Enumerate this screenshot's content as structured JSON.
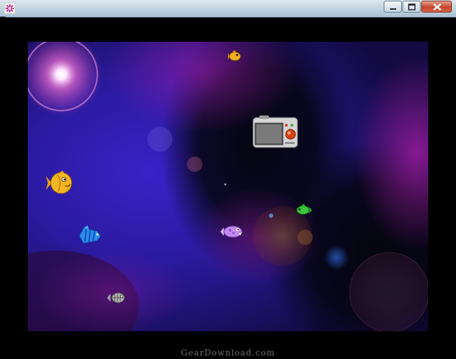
{
  "window": {
    "title": "",
    "app_icon": "starfish-gear-icon",
    "buttons": [
      {
        "name": "minimize",
        "icon": "minimize-icon"
      },
      {
        "name": "maximize",
        "icon": "maximize-icon"
      },
      {
        "name": "close",
        "icon": "close-icon"
      }
    ]
  },
  "scene": {
    "background": "nebula",
    "colors": {
      "deep_blue": "#2a1a9e",
      "magenta": "#8a1a8e",
      "space": "#050510",
      "flare": "#ffe6ff"
    },
    "sprites": [
      {
        "name": "orange-coin-fish",
        "color": "#f0b020"
      },
      {
        "name": "yellow-round-fish",
        "color": "#f2b624"
      },
      {
        "name": "blue-striped-fish",
        "color": "#2a8cf0"
      },
      {
        "name": "purple-spotted-fish",
        "color": "#c08cf0"
      },
      {
        "name": "green-fish",
        "color": "#3cc83c"
      },
      {
        "name": "gray-skeleton-fish",
        "color": "#b4b4b4"
      },
      {
        "name": "camera-icon",
        "color": "#9a9a9a"
      }
    ]
  },
  "footer": {
    "watermark": "GearDownload.com"
  }
}
